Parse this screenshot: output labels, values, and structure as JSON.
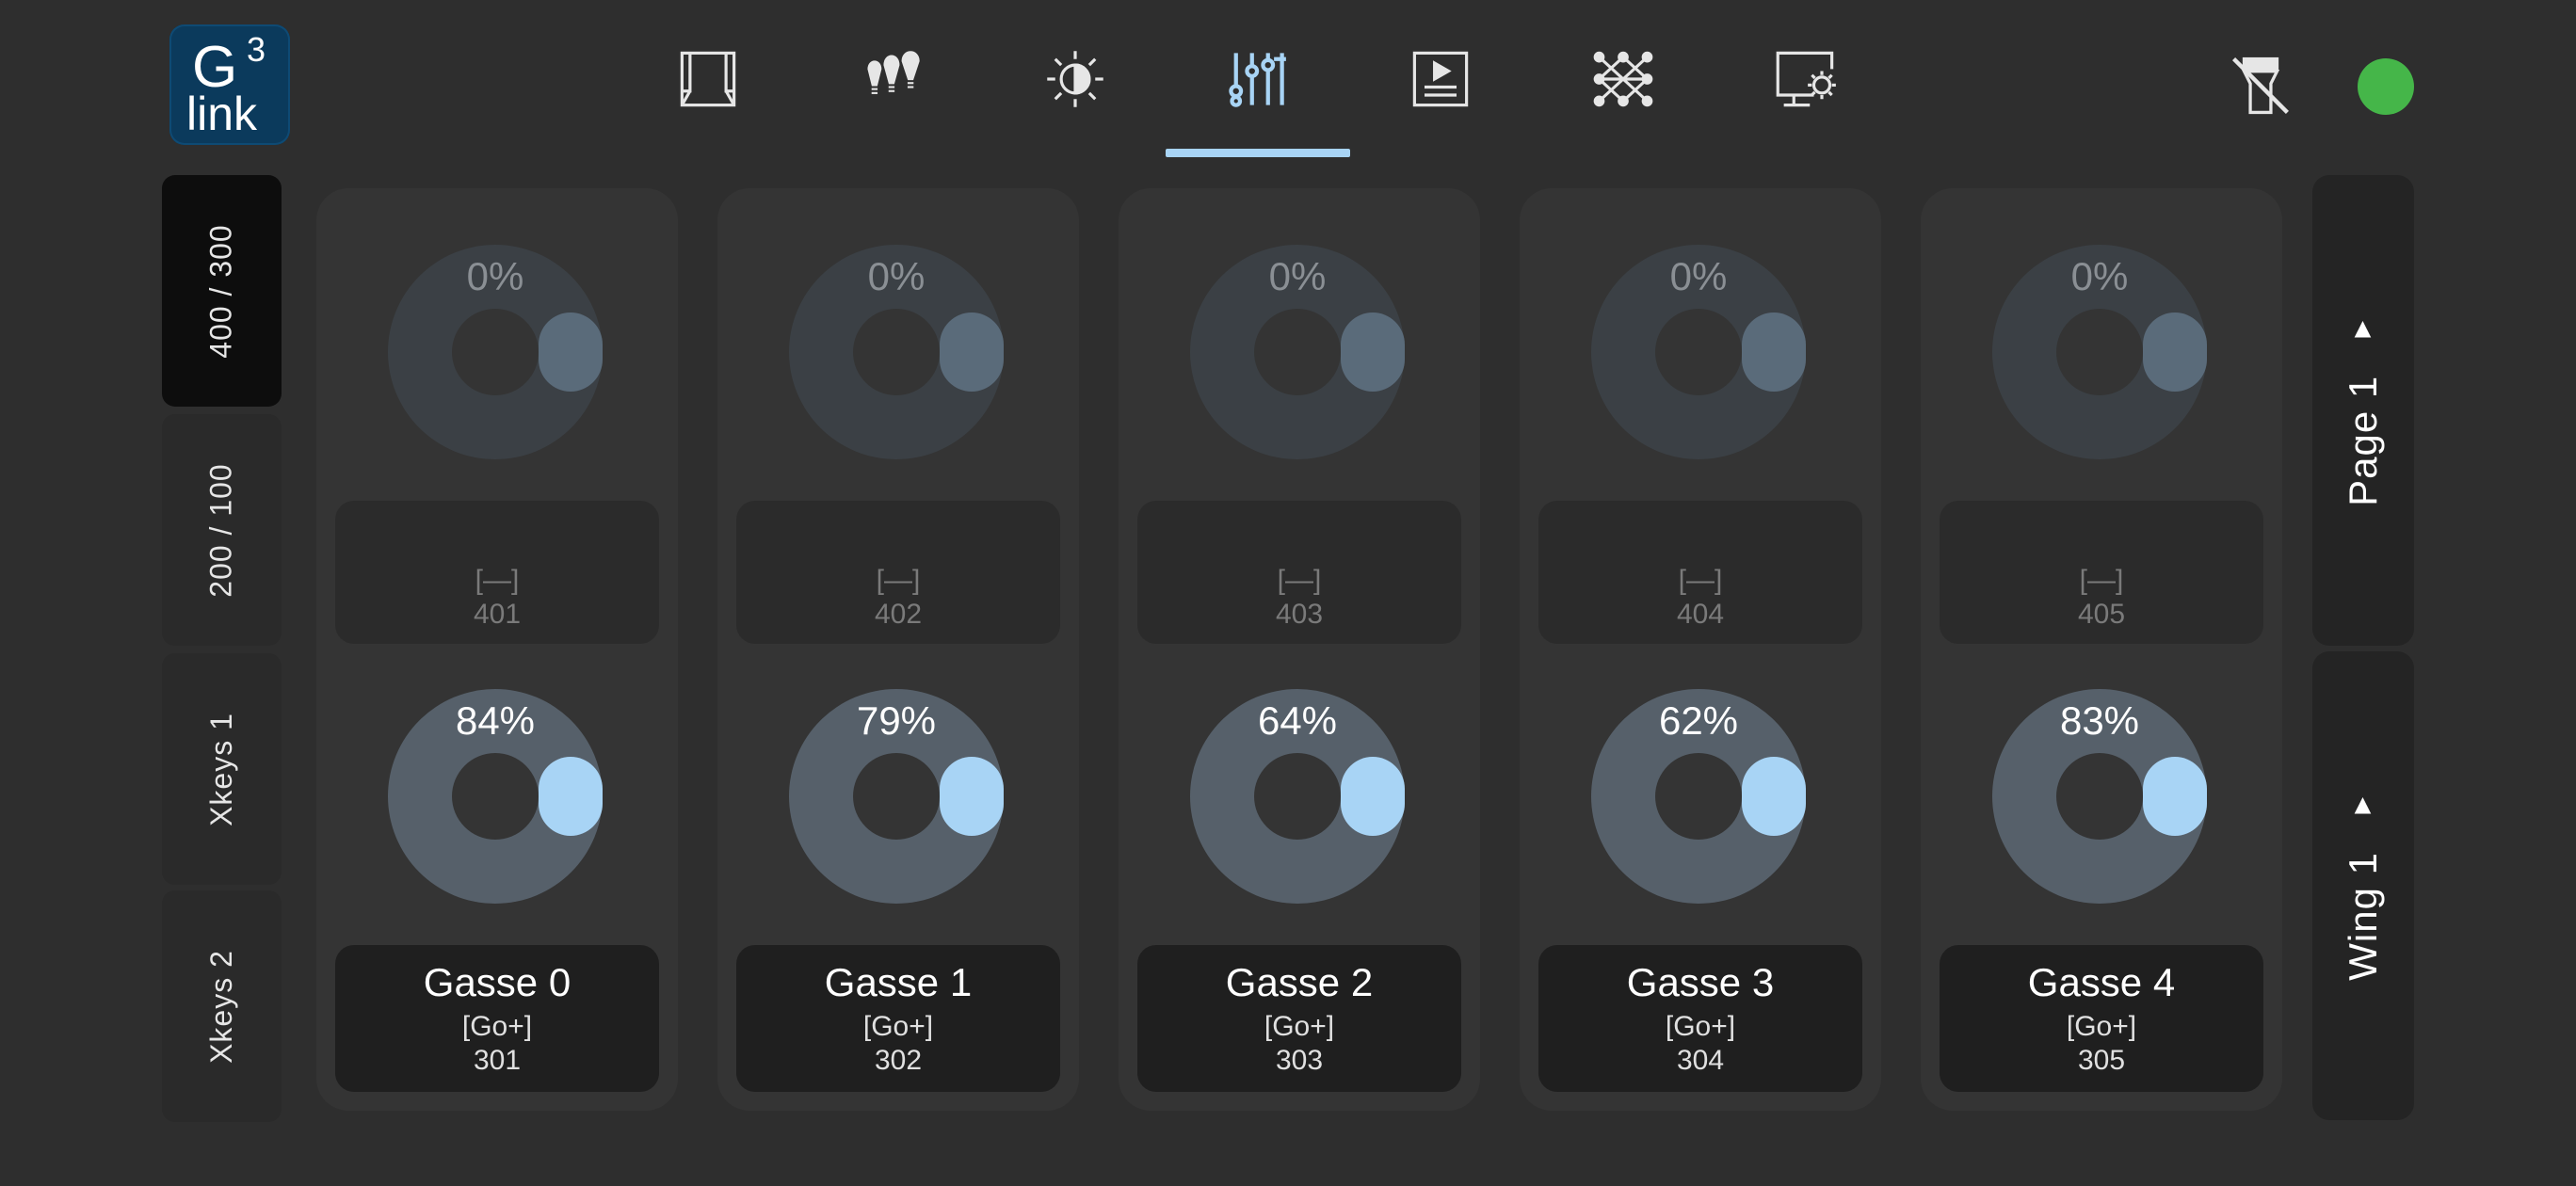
{
  "logo": {
    "main": "G",
    "superscript": "3",
    "sub": "link"
  },
  "nav": {
    "icons": [
      {
        "name": "stage-icon",
        "active": false
      },
      {
        "name": "fixtures-icon",
        "active": false
      },
      {
        "name": "intensity-icon",
        "active": false
      },
      {
        "name": "faders-icon",
        "active": true
      },
      {
        "name": "sequence-icon",
        "active": false
      },
      {
        "name": "network-icon",
        "active": false
      },
      {
        "name": "settings-display-icon",
        "active": false
      }
    ],
    "active_color": "#a8d4f5"
  },
  "status": {
    "flash_icon": "flash-off-icon",
    "connection_color": "#45b649"
  },
  "left_tabs": [
    {
      "label": "400 / 300",
      "active": true
    },
    {
      "label": "200 / 100",
      "active": false
    },
    {
      "label": "Xkeys 1",
      "active": false
    },
    {
      "label": "Xkeys 2",
      "active": false
    }
  ],
  "columns": [
    {
      "top": {
        "percent": "0%",
        "line1": "[—]",
        "line2": "401"
      },
      "bottom": {
        "percent": "84%",
        "name": "Gasse 0",
        "line1": "[Go+]",
        "line2": "301"
      }
    },
    {
      "top": {
        "percent": "0%",
        "line1": "[—]",
        "line2": "402"
      },
      "bottom": {
        "percent": "79%",
        "name": "Gasse 1",
        "line1": "[Go+]",
        "line2": "302"
      }
    },
    {
      "top": {
        "percent": "0%",
        "line1": "[—]",
        "line2": "403"
      },
      "bottom": {
        "percent": "64%",
        "name": "Gasse 2",
        "line1": "[Go+]",
        "line2": "303"
      }
    },
    {
      "top": {
        "percent": "0%",
        "line1": "[—]",
        "line2": "404"
      },
      "bottom": {
        "percent": "62%",
        "name": "Gasse 3",
        "line1": "[Go+]",
        "line2": "304"
      }
    },
    {
      "top": {
        "percent": "0%",
        "line1": "[—]",
        "line2": "405"
      },
      "bottom": {
        "percent": "83%",
        "name": "Gasse 4",
        "line1": "[Go+]",
        "line2": "305"
      }
    }
  ],
  "right_tabs": [
    {
      "label": "Page 1",
      "icon": "arrow-right-icon"
    },
    {
      "label": "Wing 1",
      "icon": "arrow-right-icon"
    }
  ]
}
